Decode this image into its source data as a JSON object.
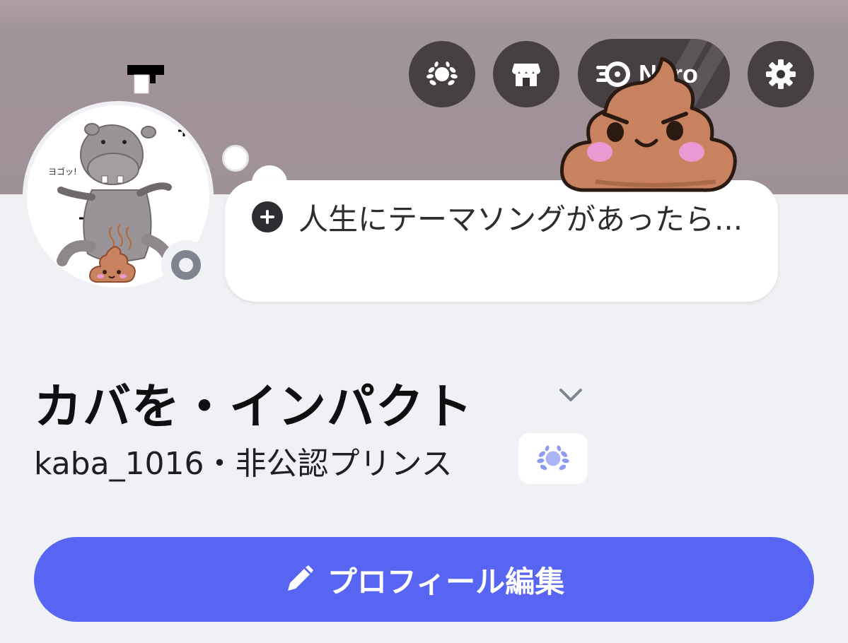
{
  "header": {
    "nitro_label": "Nitro",
    "buttons": [
      "quests-laurel-icon",
      "shop-icon",
      "nitro-icon",
      "settings-gear-icon"
    ]
  },
  "note": {
    "placeholder": "人生にテーマソングがあったら..."
  },
  "profile": {
    "display_name": "カバを・インパクト",
    "username": "kaba_1016",
    "separator": "・",
    "pronouns": "非公認プリンス",
    "avatar_text": "ヨゴッ!",
    "status": "offline"
  },
  "actions": {
    "edit_profile_label": "プロフィール編集"
  },
  "colors": {
    "banner": "#a1939a",
    "background": "#f0f1f4",
    "edit_button": "#5865f2",
    "status": "#80848e",
    "poop_body": "#c9825f",
    "poop_blush": "#e99ad2"
  }
}
